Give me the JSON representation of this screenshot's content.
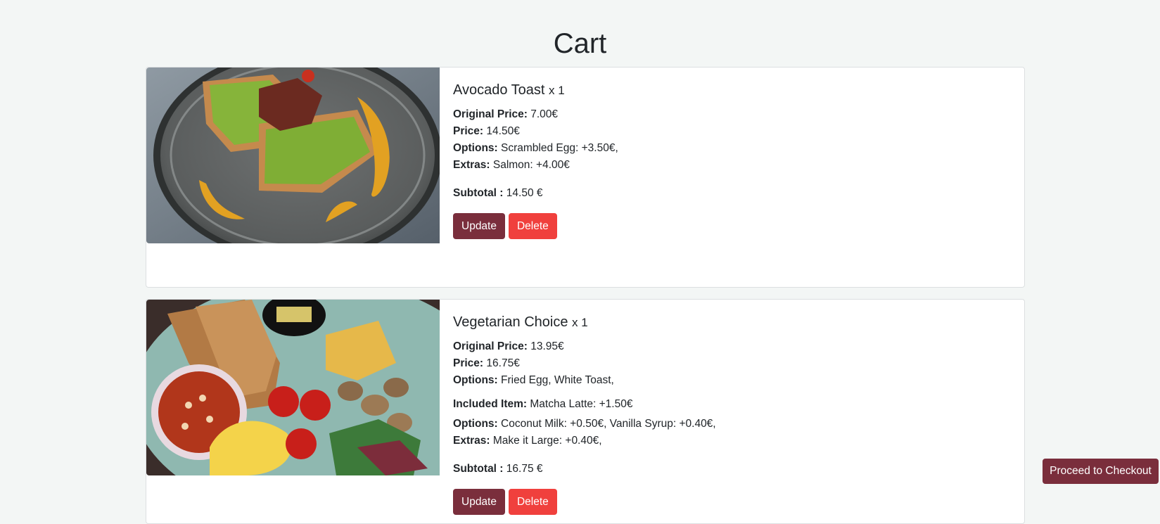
{
  "page": {
    "title": "Cart"
  },
  "colors": {
    "background": "#f3f6f5",
    "primary_button": "#7a2e3c",
    "danger_button": "#f0403d"
  },
  "cart": {
    "items": [
      {
        "name": "Avocado Toast",
        "qty": "x 1",
        "image_icon": "avocado-toast-photo",
        "fields": [
          {
            "label": "Original Price:",
            "value": " 7.00€"
          },
          {
            "label": "Price:",
            "value": " 14.50€"
          },
          {
            "label": "Options:",
            "value": " Scrambled Egg: +3.50€,"
          },
          {
            "label": "Extras:",
            "value": " Salmon: +4.00€"
          }
        ],
        "subtotal_label": "Subtotal :",
        "subtotal_value": " 14.50 €",
        "update_label": "Update",
        "delete_label": "Delete"
      },
      {
        "name": "Vegetarian Choice",
        "qty": "x 1",
        "image_icon": "vegetarian-breakfast-photo",
        "fields": [
          {
            "label": "Original Price:",
            "value": " 13.95€"
          },
          {
            "label": "Price:",
            "value": " 16.75€"
          },
          {
            "label": "Options:",
            "value": " Fried Egg, White Toast,"
          }
        ],
        "included": {
          "label": "Included Item:",
          "value": " Matcha Latte: +1.50€"
        },
        "included_fields": [
          {
            "label": "Options:",
            "value": " Coconut Milk: +0.50€, Vanilla Syrup: +0.40€,"
          },
          {
            "label": "Extras:",
            "value": " Make it Large: +0.40€,"
          }
        ],
        "subtotal_label": "Subtotal :",
        "subtotal_value": " 16.75 €",
        "update_label": "Update",
        "delete_label": "Delete"
      }
    ]
  },
  "checkout": {
    "label": "Proceed to Checkout"
  }
}
